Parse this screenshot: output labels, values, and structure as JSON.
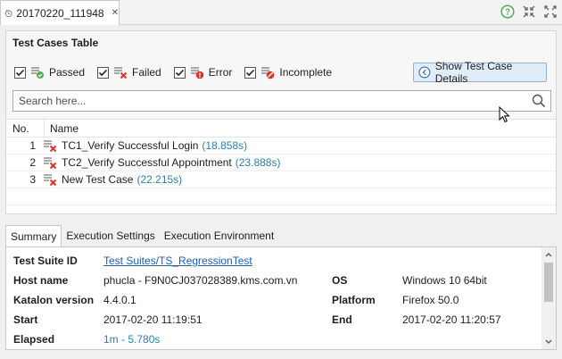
{
  "tab": {
    "title": "20170220_111948",
    "close_glyph": "✕"
  },
  "colors": {
    "accent_blue": "#2f7fa8",
    "link": "#1a5fb4",
    "fail_red": "#d9342b",
    "pass_green": "#4caf50"
  },
  "section": {
    "title": "Test Cases Table"
  },
  "filters": [
    {
      "label": "Passed",
      "icon": "passed-icon",
      "checked": true
    },
    {
      "label": "Failed",
      "icon": "failed-icon",
      "checked": true
    },
    {
      "label": "Error",
      "icon": "error-icon",
      "checked": true
    },
    {
      "label": "Incomplete",
      "icon": "incomplete-icon",
      "checked": true
    }
  ],
  "details_button": {
    "label": "Show Test Case Details"
  },
  "search": {
    "placeholder": "Search here..."
  },
  "table": {
    "columns": [
      "No.",
      "Name"
    ],
    "rows": [
      {
        "no": "1",
        "name": "TC1_Verify Successful Login",
        "duration": "(18.858s)",
        "status": "failed"
      },
      {
        "no": "2",
        "name": "TC2_Verify Successful Appointment",
        "duration": "(23.888s)",
        "status": "failed"
      },
      {
        "no": "3",
        "name": "New Test Case",
        "duration": "(22.215s)",
        "status": "failed"
      }
    ]
  },
  "bottom_tabs": [
    "Summary",
    "Execution Settings",
    "Execution Environment"
  ],
  "summary": {
    "suite_id_label": "Test Suite ID",
    "suite_id_value": "Test Suites/TS_RegressionTest",
    "host_label": "Host name",
    "host_value": "phucla - F9N0CJ037028389.kms.com.vn",
    "os_label": "OS",
    "os_value": "Windows 10 64bit",
    "katalon_label": "Katalon version",
    "katalon_value": "4.4.0.1",
    "platform_label": "Platform",
    "platform_value": "Firefox 50.0",
    "start_label": "Start",
    "start_value": "2017-02-20 11:19:51",
    "end_label": "End",
    "end_value": "2017-02-20 11:20:57",
    "elapsed_label": "Elapsed",
    "elapsed_value": "1m - 5.780s"
  }
}
